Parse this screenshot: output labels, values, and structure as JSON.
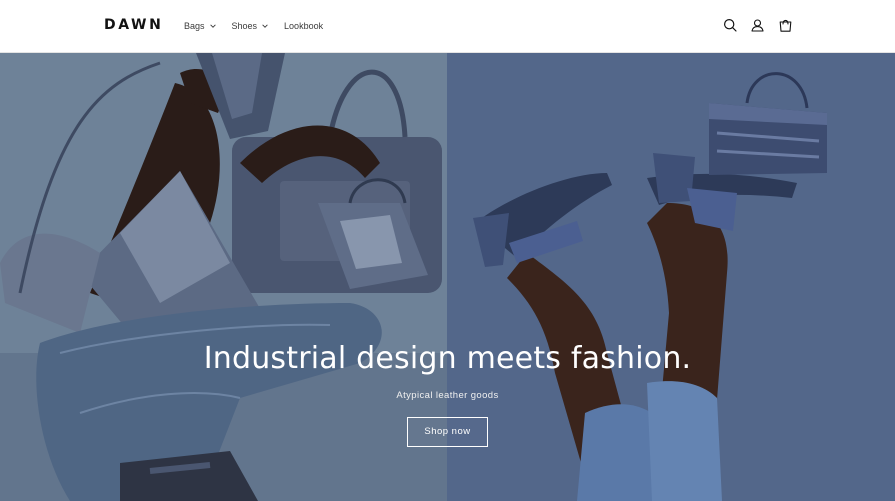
{
  "header": {
    "logo": "DAWN",
    "nav": [
      {
        "label": "Bags",
        "has_dropdown": true
      },
      {
        "label": "Shoes",
        "has_dropdown": true
      },
      {
        "label": "Lookbook",
        "has_dropdown": false
      }
    ],
    "icons": [
      "search-icon",
      "account-icon",
      "cart-icon"
    ]
  },
  "hero": {
    "headline": "Industrial design meets fashion.",
    "subheadline": "Atypical leather goods",
    "cta_label": "Shop now"
  },
  "colors": {
    "header_bg": "#ffffff",
    "text": "#121212",
    "hero_left_bg": "#6b7f96",
    "hero_right_bg": "#4f6388",
    "hero_text": "#ffffff"
  }
}
